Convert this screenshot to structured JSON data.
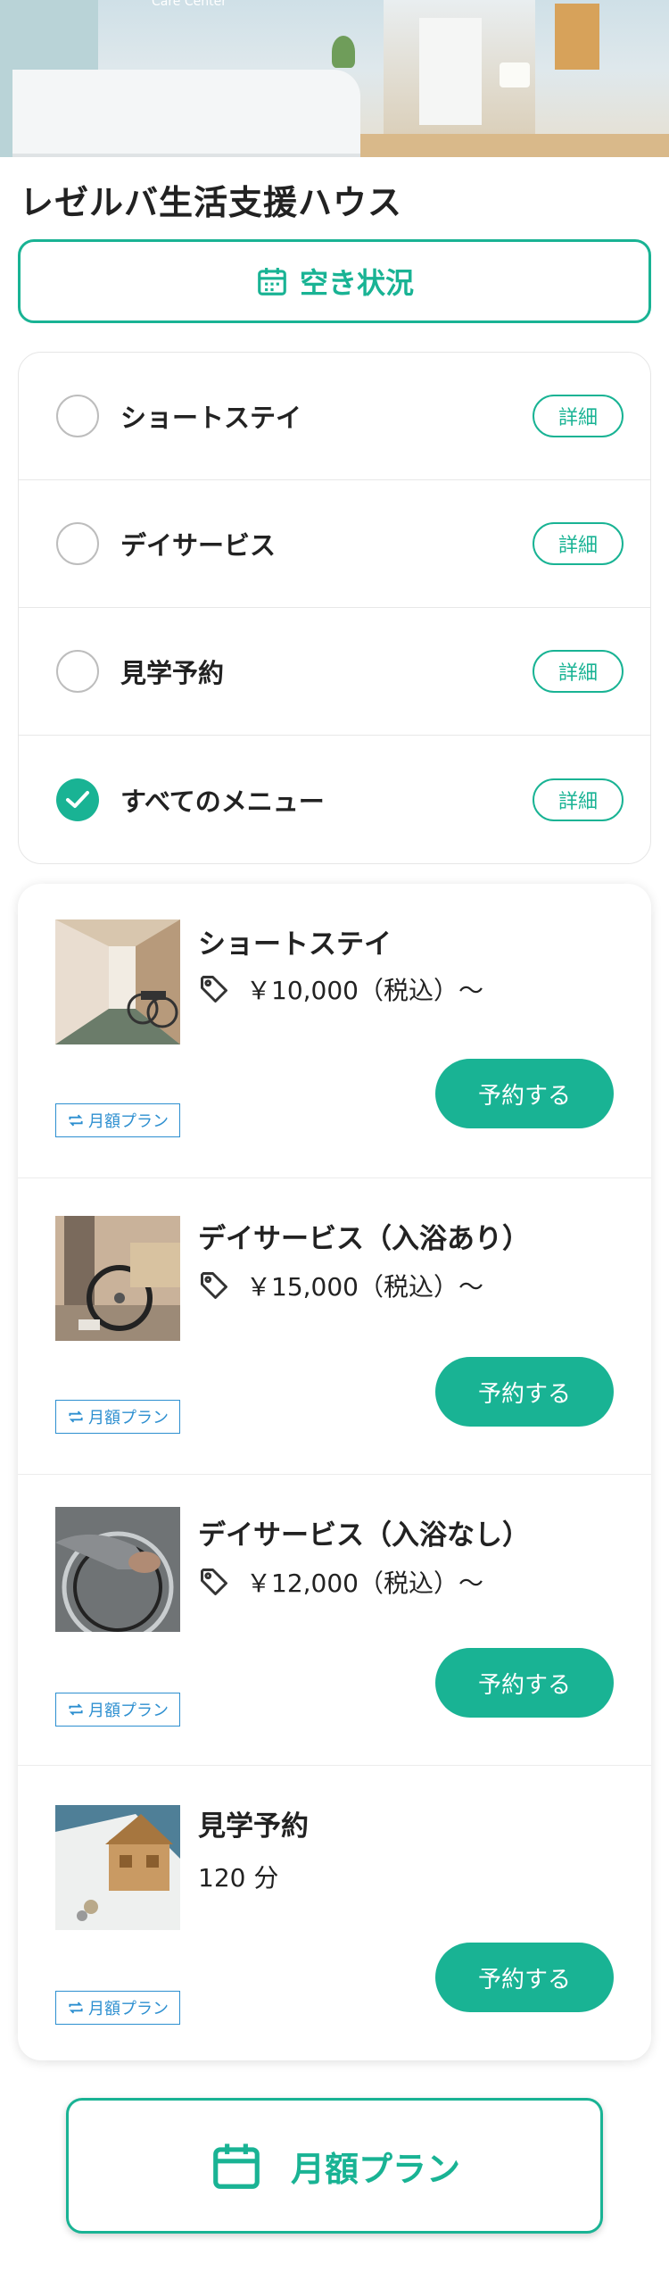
{
  "facility": {
    "name": "レゼルバ生活支援ハウス",
    "hero_logo_text": "Care Center"
  },
  "availability_button": {
    "label": "空き状況",
    "icon": "calendar-icon"
  },
  "menu_filter": {
    "items": [
      {
        "label": "ショートステイ",
        "checked": false,
        "detail_label": "詳細"
      },
      {
        "label": "デイサービス",
        "checked": false,
        "detail_label": "詳細"
      },
      {
        "label": "見学予約",
        "checked": false,
        "detail_label": "詳細"
      },
      {
        "label": "すべてのメニュー",
        "checked": true,
        "detail_label": "詳細"
      }
    ]
  },
  "plans": [
    {
      "name": "ショートステイ",
      "price": "￥10,000（税込）〜",
      "book_label": "予約する",
      "tag": "月額プラン",
      "thumb": "corridor-wheelchair-photo"
    },
    {
      "name": "デイサービス（入浴あり）",
      "price": "￥15,000（税込）〜",
      "book_label": "予約する",
      "tag": "月額プラン",
      "thumb": "wheelchair-assist-photo"
    },
    {
      "name": "デイサービス（入浴なし）",
      "price": "￥12,000（税込）〜",
      "book_label": "予約する",
      "tag": "月額プラン",
      "thumb": "wheelchair-hand-photo"
    },
    {
      "name": "見学予約",
      "duration": "120 分",
      "book_label": "予約する",
      "tag": "月額プラン",
      "thumb": "house-model-photo"
    }
  ],
  "monthly_plan_button": {
    "label": "月額プラン",
    "icon": "calendar-icon"
  },
  "colors": {
    "accent": "#19b394",
    "tag_blue": "#2d8fd0",
    "text": "#222222"
  }
}
